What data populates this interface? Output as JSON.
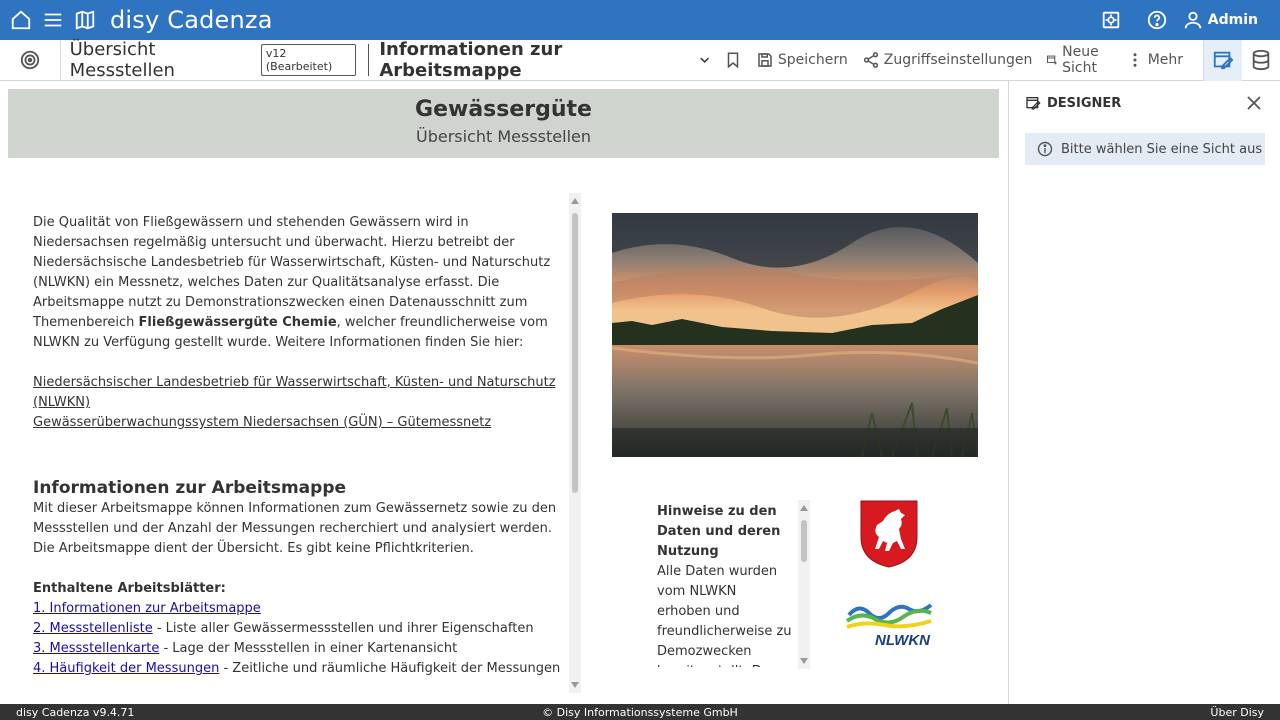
{
  "app": {
    "brand": "disy Cadenza",
    "user": "Admin"
  },
  "toolbar": {
    "workbook_title": "Übersicht Messstellen",
    "version_badge": "v12 (Bearbeitet)",
    "sheet_title": "Informationen zur Arbeitsmappe",
    "save": "Speichern",
    "access": "Zugriffseinstellungen",
    "new_view": "Neue Sicht",
    "more": "Mehr"
  },
  "banner": {
    "title": "Gewässergüte",
    "subtitle": "Übersicht Messstellen"
  },
  "content": {
    "intro_1": "Die Qualität von Fließgewässern und stehenden Gewässern wird in Niedersachsen regelmäßig untersucht und überwacht. Hierzu betreibt der Niedersächsische Landesbetrieb für Wasserwirtschaft, Küsten- und Naturschutz (NLWKN) ein Messnetz, welches Daten zur Qualitätsanalyse erfasst. Die Arbeitsmappe nutzt zu Demonstrationszwecken einen Datenausschnitt zum Themenbereich ",
    "intro_bold": "Fließgewässergüte Chemie",
    "intro_2": ", welcher freundlicherweise vom NLWKN zu Verfügung gestellt wurde. Weitere Informationen finden Sie hier:",
    "link_1": "Niedersächsischer Landesbetrieb für Wasserwirtschaft, Küsten- und Naturschutz (NLWKN)",
    "link_2": "Gewässerüberwachungssystem Niedersachsen (GÜN) – Gütemessnetz",
    "section_title": "Informationen zur Arbeitsmappe",
    "section_text": "Mit dieser Arbeitsmappe können Informationen zum Gewässernetz sowie zu den Messstellen und der Anzahl der Messungen recherchiert und analysiert werden. Die Arbeitsmappe dient der Übersicht. Es gibt keine Pflichtkriterien.",
    "sheets_heading": "Enthaltene Arbeitsblätter:",
    "sheets": [
      {
        "link": "1. Informationen zur Arbeitsmappe",
        "desc": ""
      },
      {
        "link": "2. Messstellenliste",
        "desc": " - Liste aller Gewässermessstellen und ihrer Eigenschaften"
      },
      {
        "link": "3. Messstellenkarte",
        "desc": " - Lage der Messstellen in einer Kartenansicht"
      },
      {
        "link": "4. Häufigkeit der Messungen",
        "desc": " - Zeitliche und räumliche Häufigkeit der Messungen"
      }
    ]
  },
  "hinweis": {
    "heading": "Hinweise zu den Daten und deren Nutzung",
    "text": "Alle Daten wurden vom NLWKN erhoben und freundlicherweise zu Demozwecken bereitgestellt. Das NLWKN übernimmt"
  },
  "logos": {
    "nlwkn_text": "NLWKN"
  },
  "designer": {
    "title": "DESIGNER",
    "info": "Bitte wählen Sie eine Sicht aus"
  },
  "footer": {
    "version": "disy Cadenza v9.4.71",
    "copyright": "© Disy Informationssysteme GmbH",
    "about": "Über Disy"
  },
  "colors": {
    "appbar": "#2f74c0",
    "banner": "#cfd4cf",
    "footer": "#333333",
    "designer_info": "#e3ebf4"
  }
}
